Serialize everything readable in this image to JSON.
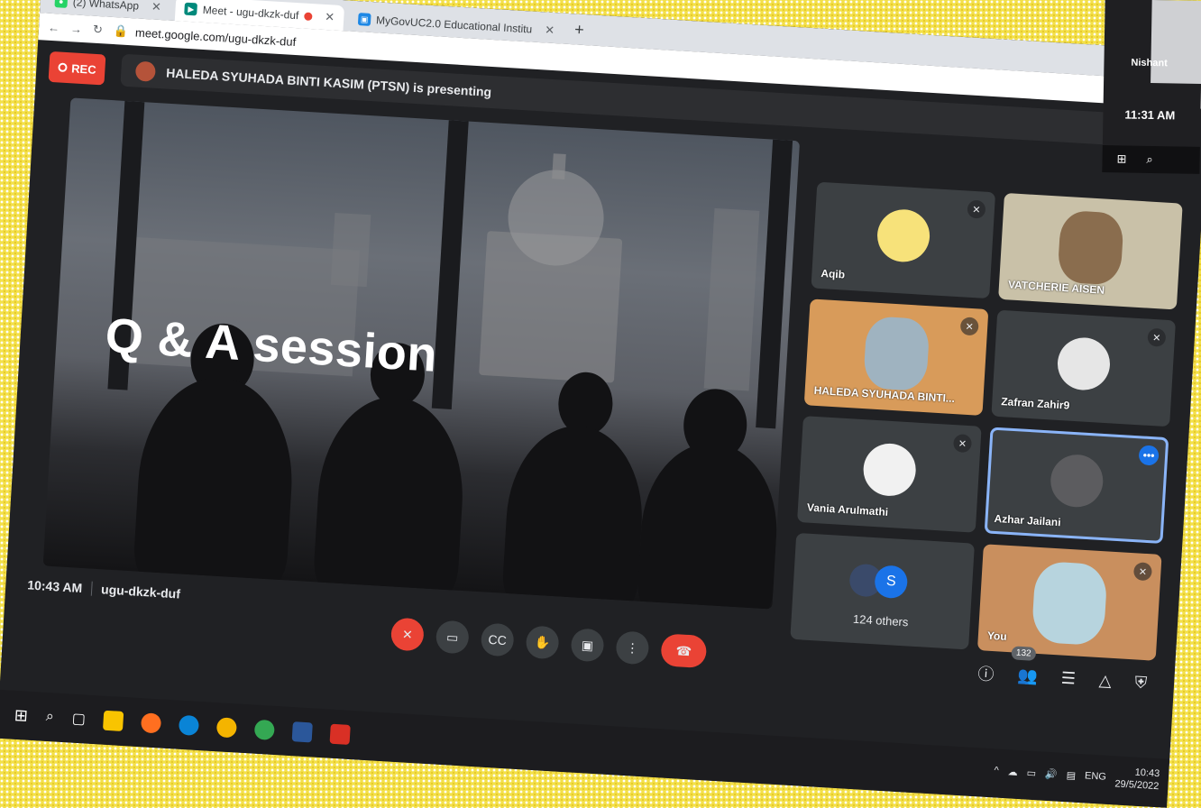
{
  "browser": {
    "tabs": [
      {
        "label": "(2) WhatsApp",
        "icon": "whatsapp-icon",
        "active": false
      },
      {
        "label": "Meet - ugu-dkzk-duf",
        "icon": "meet-icon",
        "active": true,
        "recording": true
      },
      {
        "label": "MyGovUC2.0 Educational Institu",
        "icon": "mygov-icon",
        "active": false
      }
    ],
    "new_tab_label": "+",
    "url": "meet.google.com/ugu-dkzk-duf"
  },
  "meet": {
    "rec_label": "REC",
    "presenting_text": "HALEDA SYUHADA BINTI KASIM (PTSN) is presenting",
    "stage_title": "Q & A session",
    "participants": [
      {
        "name": "Aqib",
        "muted": true,
        "avatar_color": "#f7e27a"
      },
      {
        "name": "VATCHERIE AISEN",
        "muted": false,
        "avatar_color": "#d7b58a"
      },
      {
        "name": "HALEDA SYUHADA BINTI...",
        "muted": true,
        "avatar_color": "#c9925a"
      },
      {
        "name": "Zafran Zahir9",
        "muted": true,
        "avatar_color": "#e6e6e6"
      },
      {
        "name": "Vania Arulmathi",
        "muted": true,
        "avatar_color": "#f1f1f1"
      },
      {
        "name": "Azhar Jailani",
        "muted": false,
        "avatar_color": "#5c5c5f"
      },
      {
        "name": "You",
        "muted": true,
        "avatar_color": "#d8a87c"
      }
    ],
    "others": {
      "label": "124 others",
      "initial": "S"
    },
    "time": "10:43 AM",
    "meeting_code": "ugu-dkzk-duf",
    "people_count": "132",
    "accent_color": "#8ab4f8",
    "leave_color": "#ea4335"
  },
  "taskbar": {
    "lang": "ENG",
    "clock_time": "10:43",
    "clock_date": "29/5/2022"
  },
  "second_monitor": {
    "name": "Nishant",
    "time": "11:31 AM"
  }
}
